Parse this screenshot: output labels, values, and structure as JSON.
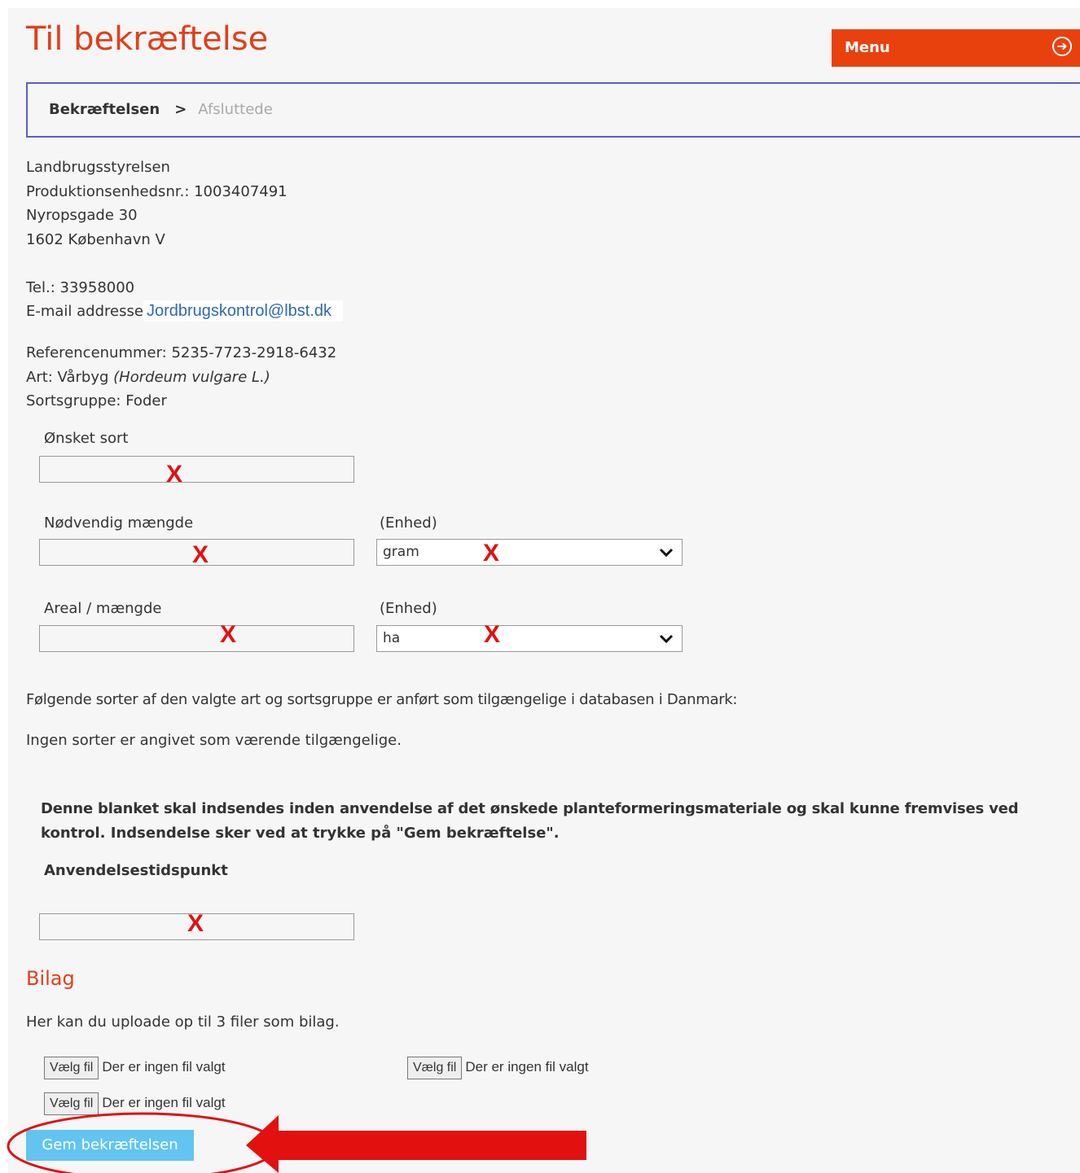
{
  "header": {
    "title": "Til bekræftelse",
    "menu_label": "Menu"
  },
  "breadcrumb": {
    "active": "Bekræftelsen",
    "separator": ">",
    "inactive": "Afsluttede"
  },
  "contact": {
    "org": "Landbrugsstyrelsen",
    "prod_unit": "Produktionsenhedsnr.: 1003407491",
    "street": "Nyropsgade 30",
    "city": "1602 København V",
    "phone": "Tel.: 33958000",
    "email_label": "E-mail addresse",
    "email": "Jordbrugskontrol@lbst.dk"
  },
  "details": {
    "reference": "Referencenummer: 5235-7723-2918-6432",
    "species_label": "Art: Vårbyg",
    "species_latin": "(Hordeum vulgare L.)",
    "group": "Sortsgruppe: Foder"
  },
  "form": {
    "desired_sort_label": "Ønsket sort",
    "amount_label": "Nødvendig mængde",
    "unit_label": "(Enhed)",
    "amount_unit": "gram",
    "area_label": "Areal / mængde",
    "area_unit_label": "(Enhed)",
    "area_unit": "ha",
    "x_mark": "X"
  },
  "info": {
    "available_text": "Følgende sorter af den valgte art og sortsgruppe er anført som tilgængelige i databasen i Danmark:",
    "none_text": "Ingen sorter er angivet som værende tilgængelige.",
    "notice_line1": "Denne blanket skal indsendes inden anvendelse af det ønskede planteformeringsmateriale og skal kunne fremvises ved",
    "notice_line2": "kontrol. Indsendelse sker ved at trykke på \"Gem bekræftelse\".",
    "usage_time_label": "Anvendelsestidspunkt"
  },
  "attachments": {
    "title": "Bilag",
    "description": "Her kan du uploade op til 3 filer som bilag.",
    "choose_file": "Vælg fil",
    "no_file": "Der er ingen fil valgt"
  },
  "save_button": "Gem bekræftelsen",
  "colors": {
    "brand": "#e8410e",
    "save": "#62c4f0",
    "annotation": "#e31010",
    "border": "#5a5fc7"
  }
}
